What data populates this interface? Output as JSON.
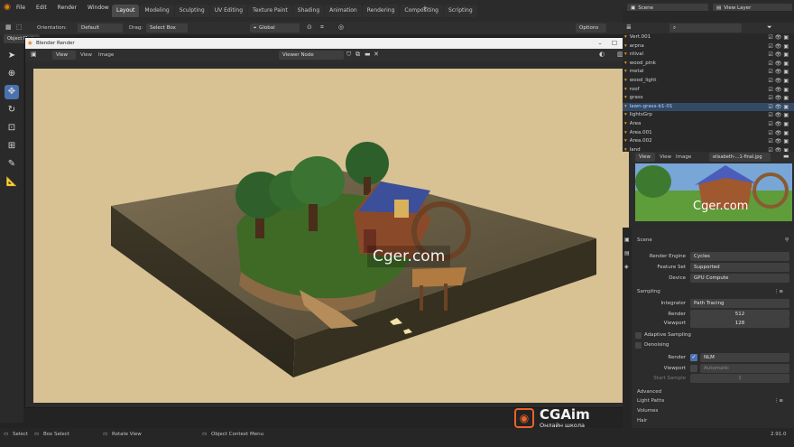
{
  "menu": [
    "File",
    "Edit",
    "Render",
    "Window",
    "Help"
  ],
  "workspaces": [
    "Layout",
    "Modeling",
    "Sculpting",
    "UV Editing",
    "Texture Paint",
    "Shading",
    "Animation",
    "Rendering",
    "Compositing",
    "Scripting"
  ],
  "active_workspace": "Layout",
  "scene": "Scene",
  "view_layer": "View Layer",
  "header": {
    "orientation_label": "Orientation:",
    "orientation_value": "Default",
    "drag_label": "Drag:",
    "drag_value": "Select Box",
    "transform": "Global",
    "options": "Options"
  },
  "object_mode": "Object Mode",
  "render_window": {
    "title": "Blender Render",
    "view_button": "View",
    "menu_view": "View",
    "menu_image": "Image",
    "slot": "Viewer Node"
  },
  "watermarks": {
    "left": "Cger.com",
    "right": "Cger.com"
  },
  "outliner": [
    {
      "label": "Vert.001"
    },
    {
      "label": "arpna"
    },
    {
      "label": "ntival"
    },
    {
      "label": "wood_pink"
    },
    {
      "label": "metal"
    },
    {
      "label": "wood_light"
    },
    {
      "label": "roof"
    },
    {
      "label": "grass"
    },
    {
      "label": "lawn-grass-b1-01",
      "selected": true
    },
    {
      "label": "lightsGrp"
    },
    {
      "label": "Area"
    },
    {
      "label": "Area.001"
    },
    {
      "label": "Area.002"
    },
    {
      "label": "land"
    }
  ],
  "image_editor": {
    "view": "View",
    "menu_view": "View",
    "menu_image": "Image",
    "image_name": "elisabeth-...1-final.jpg"
  },
  "properties": {
    "scene_label": "Scene",
    "render_engine_label": "Render Engine",
    "render_engine": "Cycles",
    "feature_set_label": "Feature Set",
    "feature_set": "Supported",
    "device_label": "Device",
    "device": "GPU Compute",
    "sampling_label": "Sampling",
    "integrator_label": "Integrator",
    "integrator": "Path Tracing",
    "render_samples_label": "Render",
    "render_samples": "512",
    "viewport_samples_label": "Viewport",
    "viewport_samples": "128",
    "adaptive_label": "Adaptive Sampling",
    "denoising_label": "Denoising",
    "denoise_render_label": "Render",
    "denoise_render": "NLM",
    "denoise_viewport_label": "Viewport",
    "denoise_viewport": "Automatic",
    "start_sample_label": "Start Sample",
    "start_sample": "1",
    "advanced_label": "Advanced",
    "light_paths_label": "Light Paths",
    "volumes_label": "Volumes",
    "hair_label": "Hair"
  },
  "status": {
    "select": "Select",
    "box_select": "Box Select",
    "rotate_view": "Rotate View",
    "context_menu": "Object Context Menu",
    "version": "2.91.0"
  },
  "logo": {
    "name": "CGAim",
    "tagline": "Онлайн школа"
  },
  "colors": {
    "accent": "#4b72b0",
    "canvas_bg": "#d8c193",
    "logo_orange": "#e8632b"
  }
}
